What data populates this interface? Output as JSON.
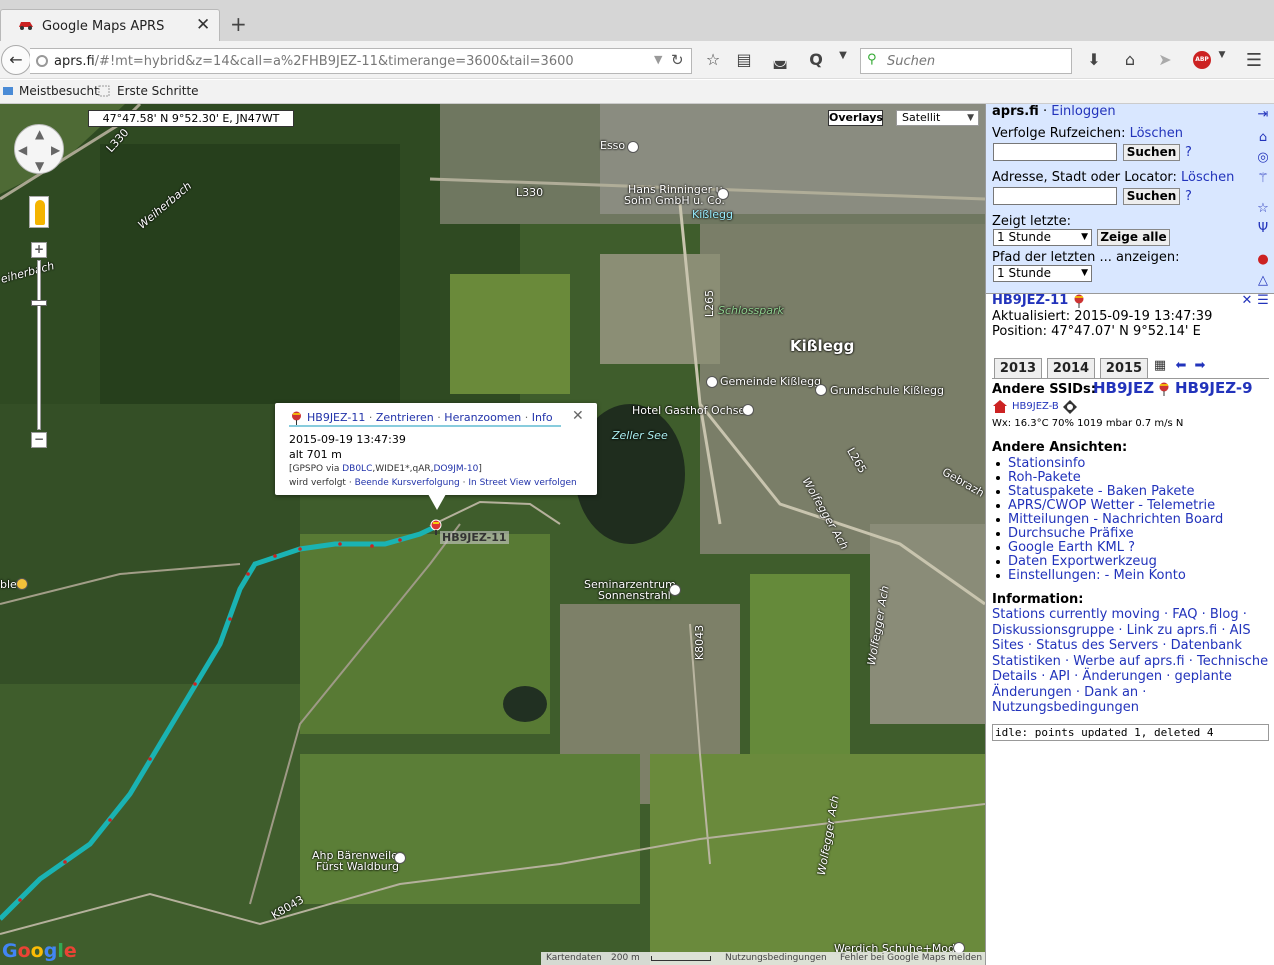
{
  "browser": {
    "tab_title": "Google Maps APRS",
    "url_host": "aprs.fi",
    "url_path": "/#!mt=hybrid&z=14&call=a%2FHB9JEZ-11&timerange=3600&tail=3600",
    "search_placeholder": "Suchen",
    "abp_label": "ABP",
    "bookmarks": [
      "Meistbesucht",
      "Erste Schritte"
    ]
  },
  "map": {
    "coords_readout": "47°47.58' N 9°52.30' E, JN47WT",
    "overlays_label": "Overlays",
    "maptype_selected": "Satellit",
    "labels": {
      "esso": "Esso",
      "hans": "Hans Rinninger u.",
      "sohn": "Sohn GmbH u. Co.",
      "kisslegg_station": "Kißlegg",
      "l330_top": "L330",
      "l330_left": "L330",
      "weiherbach1": "Weiherbach",
      "weiherbach2": "eiherbach",
      "l265": "L265",
      "schlosspark": "Schlosspark",
      "kisslegg_town": "Kißlegg",
      "gemeinde": "Gemeinde Kißlegg",
      "grundschule": "Grundschule Kißlegg",
      "hotel": "Hotel Gasthof Ochsen",
      "zeller_see": "Zeller See",
      "l265b": "L265",
      "gebrazh": "Gebrazh",
      "wolfegger1": "Wolfegger Ach",
      "seminar1": "Seminarzentrum",
      "seminar2": "Sonnenstrahl",
      "k8043": "K8043",
      "wolfegger2": "Wolfegger Ach",
      "ahp1": "Ahp Bärenweiler",
      "ahp2": "Fürst Waldburg",
      "k8043b": "K8043",
      "wolfegger3": "Wolfegger Ach",
      "werdich": "Werdich Schuhe+Mode",
      "ble": "ble"
    },
    "marker_label": "HB9JEZ-11",
    "footer": {
      "kartendaten": "Kartendaten",
      "scale": "200 m",
      "nutzung": "Nutzungsbedingungen",
      "fehler": "Fehler bei Google Maps melden"
    },
    "popup": {
      "callsign": "HB9JEZ-11",
      "zentrieren": "Zentrieren",
      "heranzoomen": "Heranzoomen",
      "info": "Info",
      "sep": "·",
      "time": "2015-09-19 13:47:39",
      "alt": "alt 701 m",
      "path_a": "[GPSPO via",
      "path_b": "DB0LC",
      "path_c": ",WIDE1*,qAR,",
      "path_d": "DO9JM-10",
      "path_e": "]",
      "tracked": "wird verfolgt ·",
      "stop": "Beende Kursverfolgung",
      "streetview": "In Street View verfolgen"
    }
  },
  "panel": {
    "site": "aprs.fi",
    "sep": "·",
    "login": "Einloggen",
    "track_label": "Verfolge Rufzeichen:",
    "clear": "Löschen",
    "search_btn": "Suchen",
    "help": "?",
    "addr_label": "Adresse, Stadt oder Locator:",
    "show_last_label": "Zeigt letzte:",
    "show_last_value": "1 Stunde",
    "show_all_btn": "Zeige alle",
    "path_label": "Pfad der letzten ... anzeigen:",
    "path_value": "1 Stunde",
    "station": {
      "callsign": "HB9JEZ-11",
      "updated": "Aktualisiert: 2015-09-19 13:47:39",
      "position": "Position: 47°47.07' N 9°52.14' E"
    },
    "years": [
      "2013",
      "2014",
      "2015"
    ],
    "other_ssids_label": "Andere SSIDs:",
    "ssid1": "HB9JEZ",
    "ssid2": "HB9JEZ-9",
    "wx_station": "HB9JEZ-B",
    "wx": "Wx: 16.3°C 70% 1019 mbar 0.7 m/s N",
    "views_label": "Andere Ansichten:",
    "views": [
      "Stationsinfo",
      "Roh-Pakete",
      "Statuspakete - Baken Pakete",
      "APRS/CWOP Wetter - Telemetrie",
      "Mitteilungen - Nachrichten Board",
      "Durchsuche Präfixe",
      "Google Earth KML ?",
      "Daten Exportwerkzeug",
      "Einstellungen: - Mein Konto"
    ],
    "info_label": "Information:",
    "info_lines": [
      "Stations currently moving · FAQ · Blog ·",
      "Diskussionsgruppe · Link zu aprs.fi · AIS",
      "Sites · Status des Servers · Datenbank",
      "Statistiken · Werbe auf aprs.fi · Technische",
      "Details · API · Änderungen · geplante",
      "Änderungen · Dank an ·",
      "Nutzungsbedingungen"
    ],
    "status": "idle: points updated 1, deleted 4"
  },
  "colors": {
    "track": "#1ab3b3",
    "link": "#2233bb",
    "panel_bg": "#d9e7ff"
  }
}
